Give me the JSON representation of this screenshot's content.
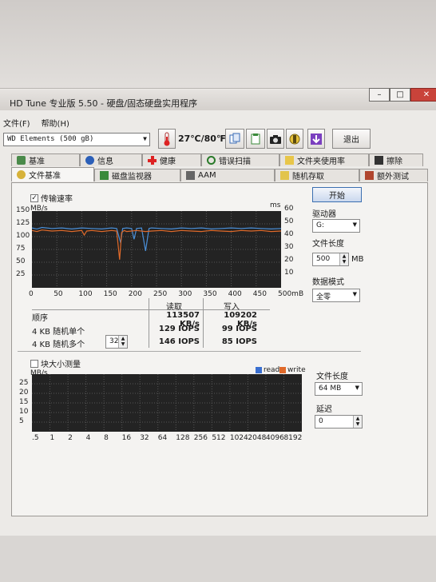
{
  "app": {
    "title": "HD Tune 专业版 5.50 - 硬盘/固态硬盘实用程序",
    "win_min": "–",
    "win_max": "□",
    "win_close": "✕"
  },
  "menu": {
    "file": "文件(F)",
    "help": "帮助(H)"
  },
  "toolbar": {
    "drive": "WD     Elements (500 gB)",
    "temperature": "27℃/80℉",
    "exit": "退出"
  },
  "tabs_top": [
    "基准",
    "信息",
    "健康",
    "错误扫描",
    "文件夹使用率",
    "擦除"
  ],
  "tabs_bottom": [
    "文件基准",
    "磁盘监视器",
    "AAM",
    "随机存取",
    "额外测试"
  ],
  "transfer": {
    "checkbox_label": "传输速率",
    "checked": "✓",
    "y_unit_left": "MB/s",
    "y_unit_right": "ms",
    "y_ticks_left": [
      "150",
      "125",
      "100",
      "75",
      "50",
      "25"
    ],
    "y_ticks_right": [
      "60",
      "50",
      "40",
      "30",
      "20",
      "10"
    ],
    "x_ticks": [
      "0",
      "50",
      "100",
      "150",
      "200",
      "250",
      "300",
      "350",
      "400",
      "450",
      "500mB"
    ]
  },
  "results": {
    "col_read": "读取",
    "col_write": "写入",
    "rows": [
      {
        "label": "顺序",
        "read": "113507 KB/s",
        "write": "109202 KB/s"
      },
      {
        "label": "4 KB 随机单个",
        "read": "129 IOPS",
        "write": "99 IOPS"
      },
      {
        "label": "4 KB 随机多个",
        "read": "146 IOPS",
        "write": "85 IOPS"
      }
    ],
    "queue_depth": "32"
  },
  "right_panel": {
    "start": "开始",
    "drive_label": "驱动器",
    "drive_value": "G:",
    "file_len_label": "文件长度",
    "file_len_value": "500",
    "file_len_unit": "MB",
    "data_mode_label": "数据模式",
    "data_mode_value": "全零"
  },
  "block": {
    "checkbox_label": "块大小测量",
    "y_unit": "MB/s",
    "legend_read": "read",
    "legend_write": "write",
    "y_ticks": [
      "25",
      "20",
      "15",
      "10",
      "5"
    ],
    "x_ticks": [
      ".5",
      "1",
      "2",
      "4",
      "8",
      "16",
      "32",
      "64",
      "128",
      "256",
      "512",
      "1024",
      "2048",
      "4096",
      "8192"
    ],
    "file_len_label": "文件长度",
    "file_len_value": "64 MB",
    "delay_label": "延迟",
    "delay_value": "0"
  },
  "chart_data": {
    "type": "line",
    "x_unit": "mB",
    "xlim": [
      0,
      500
    ],
    "ylim_left": [
      0,
      150
    ],
    "ylim_right": [
      0,
      60
    ],
    "series": [
      {
        "name": "读取",
        "color": "#4a8fd8",
        "x": [
          0,
          10,
          20,
          40,
          60,
          80,
          100,
          120,
          140,
          160,
          170,
          178,
          182,
          190,
          200,
          205,
          210,
          220,
          228,
          235,
          240,
          260,
          280,
          300,
          320,
          340,
          360,
          380,
          400,
          420,
          440,
          460,
          480,
          500
        ],
        "y": [
          117,
          115,
          118,
          116,
          117,
          115,
          117,
          116,
          115,
          117,
          116,
          88,
          116,
          117,
          116,
          95,
          116,
          117,
          72,
          116,
          117,
          116,
          115,
          117,
          116,
          117,
          115,
          116,
          117,
          116,
          117,
          116,
          115,
          116
        ]
      },
      {
        "name": "写入",
        "color": "#e06a2a",
        "x": [
          0,
          10,
          20,
          40,
          60,
          80,
          100,
          105,
          110,
          120,
          140,
          160,
          170,
          176,
          180,
          185,
          190,
          200,
          210,
          228,
          240,
          260,
          280,
          300,
          320,
          340,
          360,
          380,
          400,
          420,
          440,
          460,
          480,
          500
        ],
        "y": [
          112,
          110,
          113,
          111,
          112,
          110,
          112,
          103,
          111,
          112,
          110,
          112,
          111,
          55,
          108,
          112,
          110,
          111,
          112,
          110,
          111,
          112,
          110,
          112,
          111,
          110,
          112,
          111,
          110,
          112,
          111,
          112,
          110,
          111
        ]
      }
    ]
  }
}
